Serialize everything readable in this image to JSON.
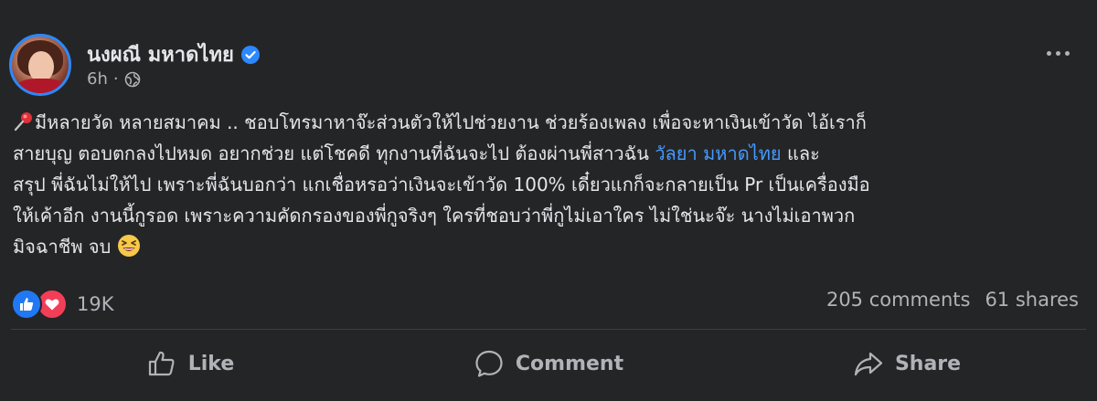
{
  "post": {
    "author": "นงผณี มหาดไทย",
    "time": "6h",
    "privacy_icon": "globe-icon",
    "verified_icon": "verified-badge-icon",
    "more_icon": "more-options-icon",
    "text": {
      "line1": "มีหลายวัด หลายสมาคม .. ชอบโทรมาหาจ๊ะส่วนตัวให้ไปช่วยงาน ช่วยร้องเพลง เพื่อจะหาเงินเข้าวัด ไอ้เราก็",
      "line2_before": "สายบุญ ตอบตกลงไปหมด อยากช่วย แต่โชคดี ทุกงานที่ฉันจะไป ต้องผ่านพี่สาวฉัน ",
      "line2_mention": "วัลยา มหาดไทย",
      "line2_after": " และ",
      "line3": "สรุป พี่ฉันไม่ให้ไป เพราะพี่ฉันบอกว่า แกเชื่อหรอว่าเงินจะเข้าวัด 100% เดี๋ยวแกก็จะกลายเป็น Pr เป็นเครื่องมือ",
      "line4": "ให้เค้าอีก งานนี้กูรอด เพราะความคัดกรองของพี่กูจริงๆ ใครที่ชอบว่าพี่กูไม่เอาใคร ไม่ใช่นะจ๊ะ นางไม่เอาพวก",
      "line5": "มิจฉาชีพ จบ"
    },
    "reactions": {
      "count": "19K",
      "types": [
        "like",
        "love"
      ]
    },
    "comments": "205 comments",
    "shares": "61 shares",
    "actions": {
      "like": "Like",
      "comment": "Comment",
      "share": "Share"
    },
    "colors": {
      "background": "#242526",
      "text": "#e4e6eb",
      "secondary": "#b0b3b8",
      "mention": "#4599ff",
      "like": "#2078f4",
      "love": "#f33e58",
      "verified": "#2d88ff"
    }
  }
}
